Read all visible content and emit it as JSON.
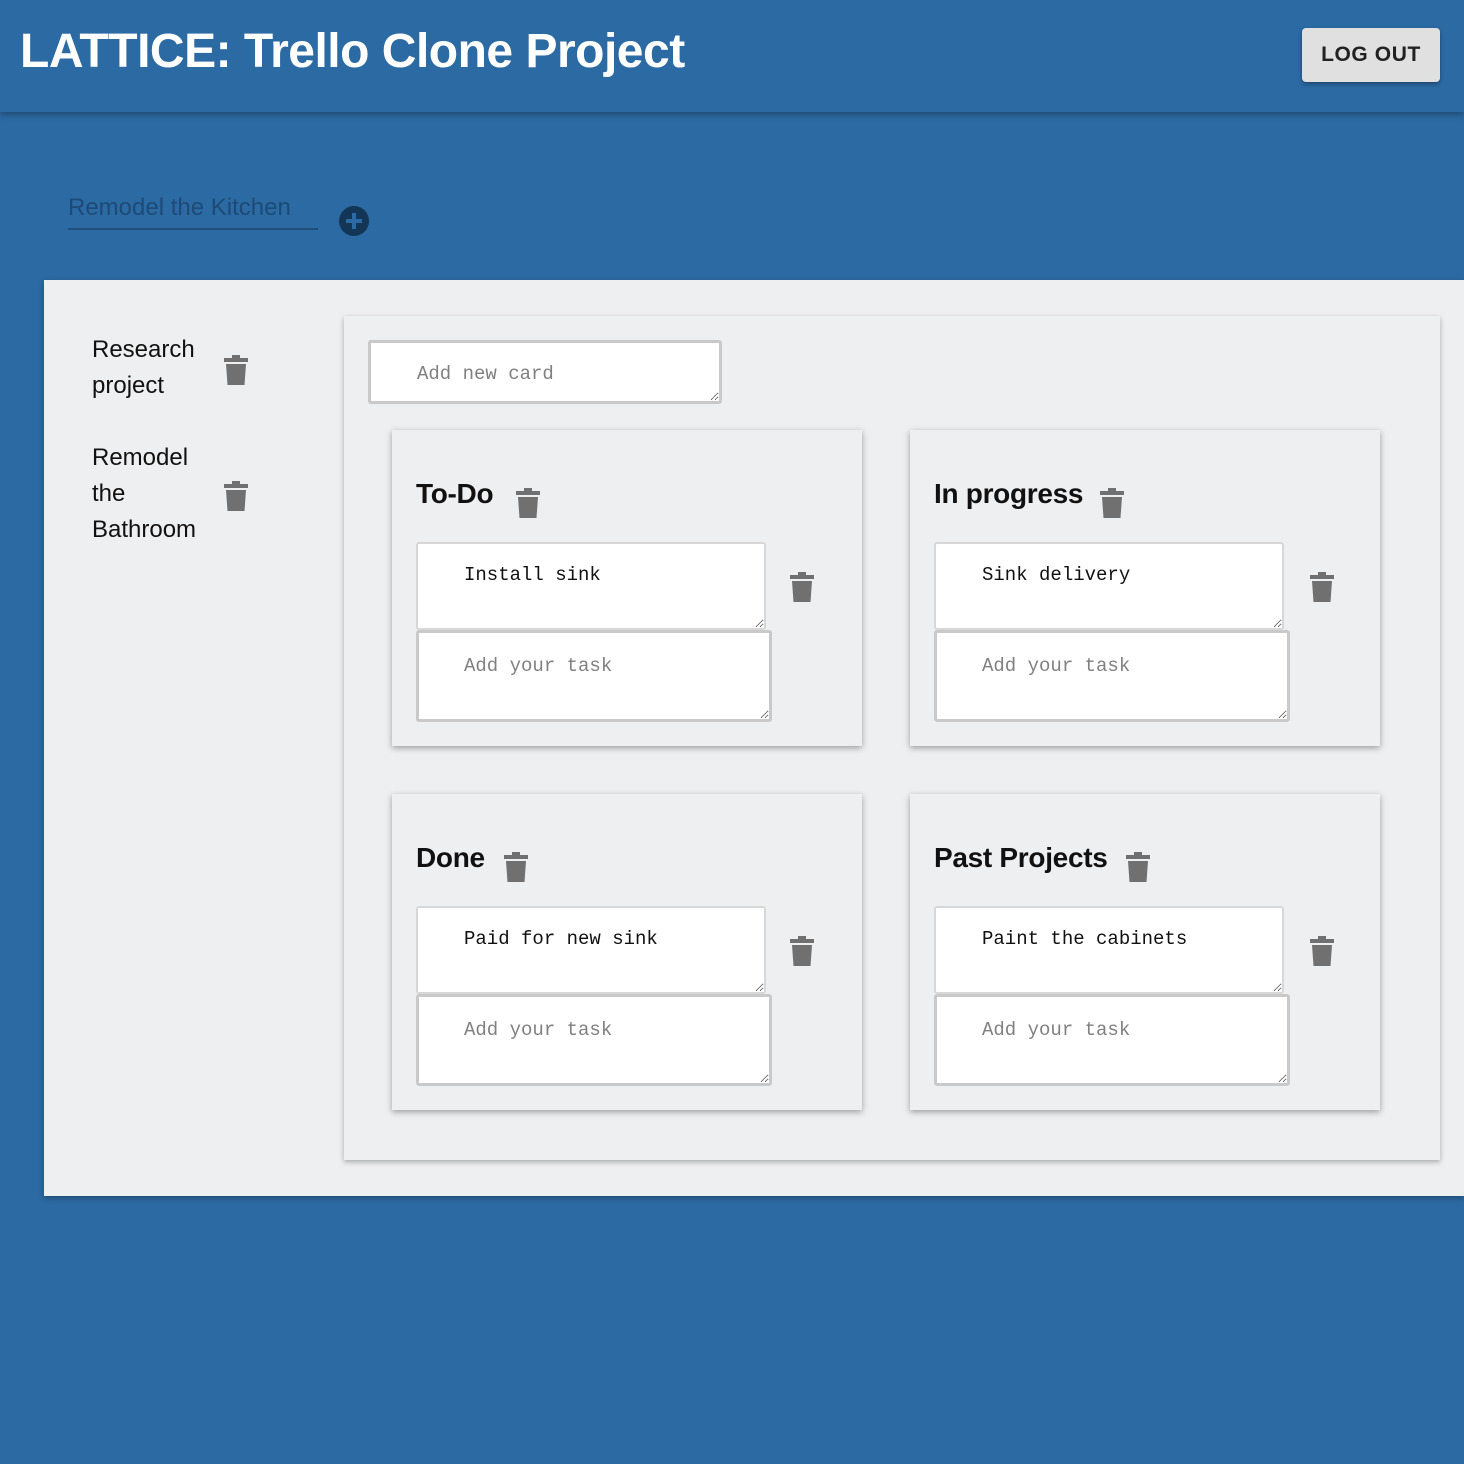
{
  "app": {
    "title": "LATTICE: Trello Clone Project",
    "logout_label": "LOG OUT"
  },
  "new_project": {
    "placeholder": "Remodel the Kitchen",
    "add_icon": "add-circle-icon"
  },
  "sidebar": {
    "items": [
      {
        "label": "Research project",
        "icon": "trash-icon"
      },
      {
        "label": "Remodel the Bathroom",
        "icon": "trash-icon"
      }
    ]
  },
  "board": {
    "add_card_placeholder": "Add new card",
    "lists": [
      {
        "title": "To-Do",
        "task": "Install sink",
        "add_task_placeholder": "Add your task"
      },
      {
        "title": "In progress",
        "task": "Sink delivery",
        "add_task_placeholder": "Add your task"
      },
      {
        "title": "Done",
        "task": "Paid for new sink",
        "add_task_placeholder": "Add your task"
      },
      {
        "title": "Past Projects",
        "task": "Paint the cabinets",
        "add_task_placeholder": "Add your task"
      }
    ]
  },
  "colors": {
    "background": "#2c6aa3",
    "panel": "#eeeff1",
    "icon": "#707070"
  }
}
